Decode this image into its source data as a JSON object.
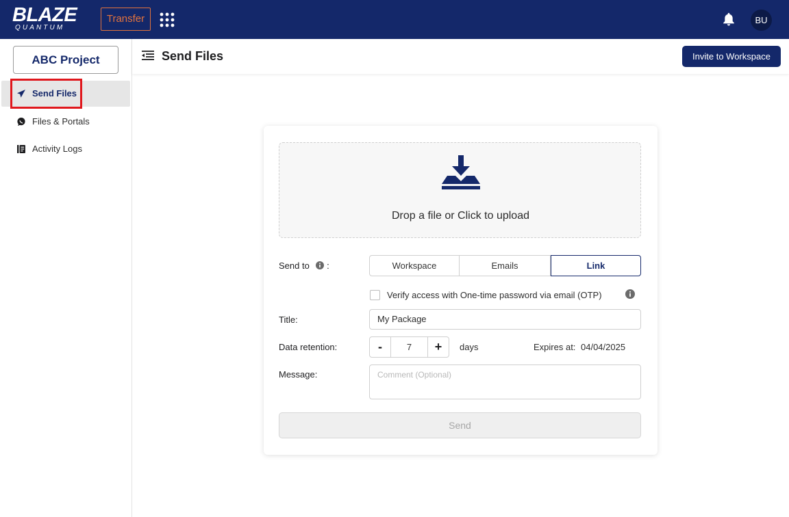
{
  "topbar": {
    "logo_main": "BLAZE",
    "logo_sub": "QUANTUM",
    "transfer_label": "Transfer",
    "avatar_initials": "BU",
    "apps_icon": "grid-icon",
    "bell_icon": "bell-icon"
  },
  "sidebar": {
    "project_label": "ABC Project",
    "items": [
      {
        "label": "Send Files",
        "icon": "paper-plane-icon",
        "active": true
      },
      {
        "label": "Files & Portals",
        "icon": "chat-bubble-icon",
        "active": false
      },
      {
        "label": "Activity Logs",
        "icon": "log-icon",
        "active": false
      }
    ]
  },
  "header": {
    "title": "Send Files",
    "invite_label": "Invite to Workspace"
  },
  "form": {
    "drop_text": "Drop a file or Click to upload",
    "send_to_label": "Send to",
    "send_to_suffix": ":",
    "send_to_options": [
      "Workspace",
      "Emails",
      "Link"
    ],
    "send_to_selected": "Link",
    "otp_label": "Verify access with One-time password via email (OTP)",
    "otp_checked": false,
    "title_label": "Title:",
    "title_value": "My Package",
    "retention_label": "Data retention:",
    "retention_minus": "-",
    "retention_value": "7",
    "retention_plus": "+",
    "retention_unit": "days",
    "expires_label": "Expires at:",
    "expires_value": "04/04/2025",
    "message_label": "Message:",
    "message_placeholder": "Comment (Optional)",
    "send_label": "Send"
  },
  "colors": {
    "brand_navy": "#14286a",
    "accent_orange": "#e3733d",
    "highlight_red": "#e0171c"
  }
}
